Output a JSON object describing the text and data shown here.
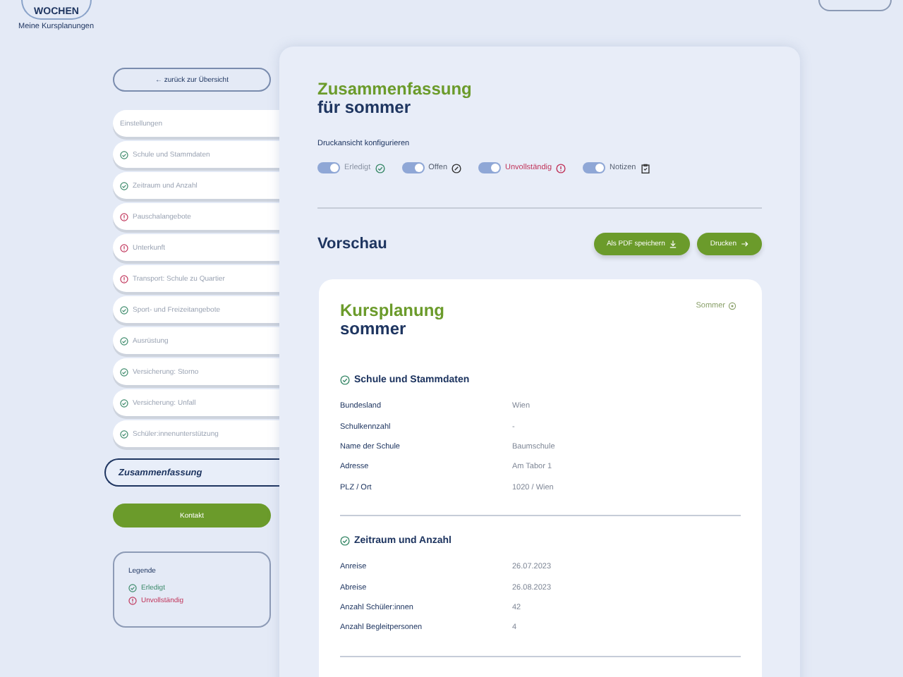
{
  "header": {
    "logo": "WOCHEN",
    "subtitle": "Meine Kursplanungen"
  },
  "sidebar": {
    "back": "← zurück zur Übersicht",
    "items": [
      {
        "label": "Einstellungen",
        "kind": "plain",
        "selected": false
      },
      {
        "label": "Schule und Stammdaten",
        "kind": "done",
        "selected": false
      },
      {
        "label": "Zeitraum und Anzahl",
        "kind": "done",
        "selected": false
      },
      {
        "label": "Pauschalangebote",
        "kind": "incomplete",
        "selected": false
      },
      {
        "label": "Unterkunft",
        "kind": "incomplete",
        "selected": false
      },
      {
        "label": "Transport: Schule zu Quartier",
        "kind": "incomplete",
        "selected": false
      },
      {
        "label": "Sport- und Freizeitangebote",
        "kind": "done",
        "selected": false
      },
      {
        "label": "Ausrüstung",
        "kind": "done",
        "selected": false
      },
      {
        "label": "Versicherung: Storno",
        "kind": "done",
        "selected": false
      },
      {
        "label": "Versicherung: Unfall",
        "kind": "done",
        "selected": false
      },
      {
        "label": "Schüler:innenunterstützung",
        "kind": "done",
        "selected": false
      },
      {
        "label": "Zusammenfassung",
        "kind": "plain",
        "selected": true
      }
    ],
    "contact": "Kontakt",
    "legend": {
      "title": "Legende",
      "items": [
        {
          "label": "Erledigt",
          "kind": "done"
        },
        {
          "label": "Unvollständig",
          "kind": "incomplete"
        }
      ]
    }
  },
  "main": {
    "title": "Zusammenfassung",
    "subtitle": "für sommer",
    "config_label": "Druckansicht konfigurieren",
    "toggles": [
      {
        "label": "Erledigt",
        "kind": "done",
        "on": true
      },
      {
        "label": "Offen",
        "kind": "open",
        "on": true
      },
      {
        "label": "Unvollständig",
        "kind": "incomplete",
        "on": true
      },
      {
        "label": "Notizen",
        "kind": "notes",
        "on": true
      }
    ],
    "preview_title": "Vorschau",
    "buttons": [
      {
        "label": "Als PDF speichern",
        "kind": "download"
      },
      {
        "label": "Drucken",
        "kind": "print"
      }
    ],
    "preview": {
      "title": "Kursplanung",
      "subtitle": "sommer",
      "tag": "Sommer",
      "sections": [
        {
          "title": "Schule und Stammdaten",
          "kind": "done",
          "rows": [
            {
              "label": "Bundesland",
              "value": "Wien"
            },
            {
              "label": "Schulkennzahl",
              "value": "-"
            },
            {
              "label": "Name der Schule",
              "value": "Baumschule"
            },
            {
              "label": "Adresse",
              "value": "Am Tabor 1"
            },
            {
              "label": "PLZ / Ort",
              "value": "1020 / Wien"
            }
          ]
        },
        {
          "title": "Zeitraum und Anzahl",
          "kind": "done",
          "rows": [
            {
              "label": "Anreise",
              "value": "26.07.2023"
            },
            {
              "label": "Abreise",
              "value": "26.08.2023"
            },
            {
              "label": "Anzahl Schüler:innen",
              "value": "42"
            },
            {
              "label": "Anzahl Begleitpersonen",
              "value": "4"
            }
          ]
        }
      ]
    }
  }
}
